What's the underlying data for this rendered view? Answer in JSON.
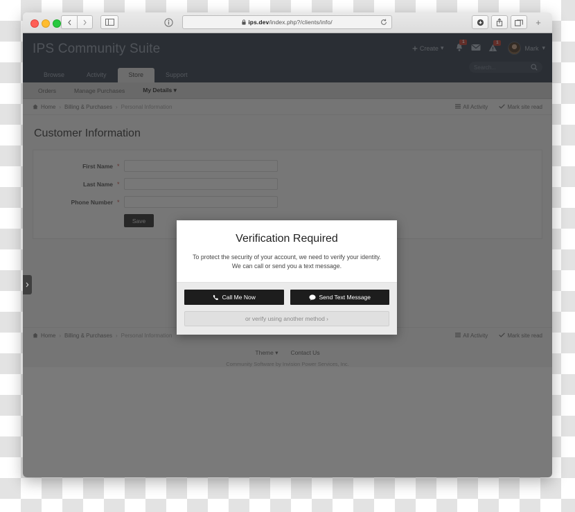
{
  "browser": {
    "url_domain": "ips.dev",
    "url_path": "/index.php?/clients/info/",
    "lock_icon": "lock-icon",
    "back_icon": "chevron-left-icon",
    "forward_icon": "chevron-right-icon",
    "sidebar_icon": "sidebar-icon",
    "reader_icon": "info-circle-icon",
    "reload_icon": "reload-icon",
    "download_icon": "download-icon",
    "share_icon": "share-icon",
    "tabs_icon": "tabs-icon",
    "new_tab_label": "+"
  },
  "site": {
    "title": "IPS Community Suite",
    "create_label": "Create",
    "user_name": "Mark",
    "notifications_badge": "1",
    "alerts_badge": "1",
    "bell_icon": "bell-icon",
    "mail_icon": "envelope-icon",
    "warning_icon": "warning-triangle-icon",
    "avatar_icon": "avatar"
  },
  "search": {
    "placeholder": "Search...",
    "icon": "search-icon"
  },
  "nav_primary": [
    {
      "label": "Browse",
      "active": false
    },
    {
      "label": "Activity",
      "active": false
    },
    {
      "label": "Store",
      "active": true
    },
    {
      "label": "Support",
      "active": false
    }
  ],
  "nav_secondary": [
    {
      "label": "Orders",
      "active": false
    },
    {
      "label": "Manage Purchases",
      "active": false
    },
    {
      "label": "My Details",
      "active": true,
      "caret": "▾"
    }
  ],
  "breadcrumb": {
    "home_icon": "home-icon",
    "items": [
      "Home",
      "Billing & Purchases",
      "Personal Information"
    ],
    "separator": "›",
    "all_activity": "All Activity",
    "all_activity_icon": "list-icon",
    "mark_read": "Mark site read",
    "mark_read_icon": "check-icon"
  },
  "main": {
    "page_title": "Customer Information",
    "fields": [
      {
        "label": "First Name",
        "required": "*",
        "value": "",
        "placeholder": ""
      },
      {
        "label": "Last Name",
        "required": "*",
        "value": "",
        "placeholder": ""
      },
      {
        "label": "Phone Number",
        "required": "*",
        "value": "",
        "placeholder": ""
      }
    ],
    "save_label": "Save"
  },
  "modal": {
    "title": "Verification Required",
    "description": "To protect the security of your account, we need to verify your identity. We can call or send you a text message.",
    "call_label": "Call Me Now",
    "call_icon": "phone-icon",
    "text_label": "Send Text Message",
    "text_icon": "chat-bubble-icon",
    "alt_label": "or verify using another method ›"
  },
  "footer": {
    "theme_label": "Theme",
    "theme_caret": "▾",
    "contact_label": "Contact Us",
    "copyright": "Community Software by Invision Power Services, Inc."
  },
  "side_handle": {
    "icon": "chevron-right-icon"
  },
  "colors": {
    "header_bg": "#2e3847",
    "accent_badge": "#c0392b",
    "required_star": "#b9413a",
    "button_dark": "#1d1d1d"
  }
}
